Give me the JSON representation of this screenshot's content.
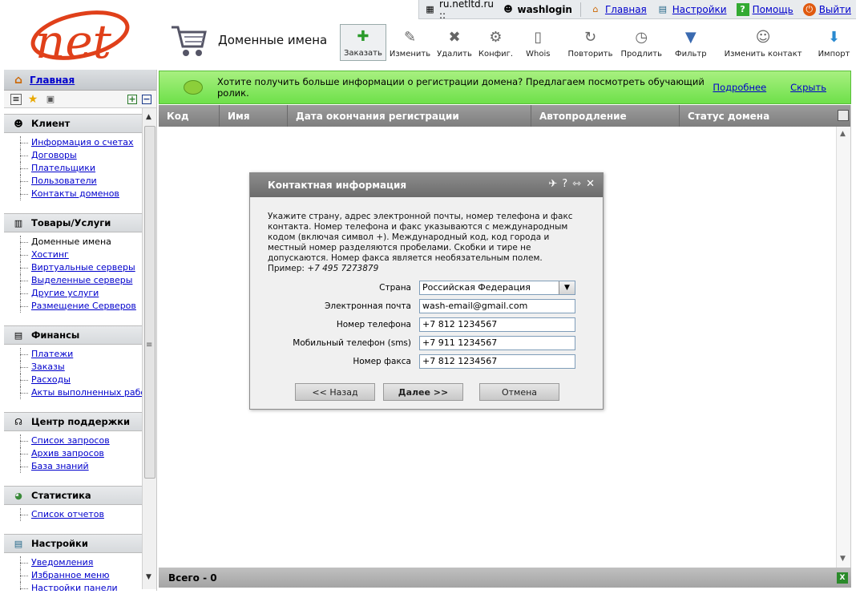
{
  "topbar": {
    "server": "ru.netltd.ru ::",
    "user": "washlogin",
    "links": [
      "Главная",
      "Настройки",
      "Помощь",
      "Выйти"
    ]
  },
  "logo": {
    "text": "net"
  },
  "page": {
    "title": "Доменные имена"
  },
  "toolbar": [
    {
      "label": "Заказать",
      "icon": "plus-doc-icon"
    },
    {
      "label": "Изменить",
      "icon": "edit-icon"
    },
    {
      "label": "Удалить",
      "icon": "delete-icon"
    },
    {
      "label": "Конфиг.",
      "icon": "config-icon"
    },
    {
      "label": "Whois",
      "icon": "whois-icon"
    },
    {
      "label": "Повторить",
      "icon": "repeat-icon"
    },
    {
      "label": "Продлить",
      "icon": "renew-icon"
    },
    {
      "label": "Фильтр",
      "icon": "filter-icon"
    },
    {
      "label": "Изменить контакт",
      "icon": "contact-edit-icon"
    },
    {
      "label": "Импорт",
      "icon": "import-icon"
    }
  ],
  "sidebar": {
    "home": "Главная",
    "groups": [
      {
        "title": "Клиент",
        "items": [
          "Информация о счетах",
          "Договоры",
          "Плательщики",
          "Пользователи",
          "Контакты доменов"
        ]
      },
      {
        "title": "Товары/Услуги",
        "items": [
          "Доменные имена",
          "Хостинг",
          "Виртуальные серверы",
          "Выделенные серверы",
          "Другие услуги",
          "Размещение Серверов"
        ]
      },
      {
        "title": "Финансы",
        "items": [
          "Платежи",
          "Заказы",
          "Расходы",
          "Акты выполненных работ"
        ]
      },
      {
        "title": "Центр поддержки",
        "items": [
          "Список запросов",
          "Архив запросов",
          "База знаний"
        ]
      },
      {
        "title": "Статистика",
        "items": [
          "Список отчетов"
        ]
      },
      {
        "title": "Настройки",
        "items": [
          "Уведомления",
          "Избранное меню",
          "Настройки панели"
        ]
      }
    ]
  },
  "banner": {
    "text": "Хотите получить больше информации о регистрации домена? Предлагаем посмотреть обучающий ролик.",
    "more": "Подробнее",
    "hide": "Скрыть"
  },
  "grid": {
    "columns": [
      "Код",
      "Имя",
      "Дата окончания регистрации",
      "Автопродление",
      "Статус домена"
    ],
    "footer": "Всего - 0"
  },
  "dialog": {
    "title": "Контактная информация",
    "description": "Укажите страну, адрес электронной почты, номер телефона и факс контакта. Номер телефона и факс указываются с международным кодом (включая символ +). Международный код, код города и местный номер разделяются пробелами. Скобки и тире не допускаются. Номер факса является необязательным полем.",
    "example_label": "Пример:",
    "example_value": "+7 495 7273879",
    "fields": [
      {
        "label": "Страна",
        "value": "Российская Федерация"
      },
      {
        "label": "Электронная почта",
        "value": "wash-email@gmail.com"
      },
      {
        "label": "Номер телефона",
        "value": "+7 812 1234567"
      },
      {
        "label": "Мобильный телефон (sms)",
        "value": "+7 911 1234567"
      },
      {
        "label": "Номер факса",
        "value": "+7 812 1234567"
      }
    ],
    "buttons": {
      "back": "<< Назад",
      "next": "Далее >>",
      "cancel": "Отмена"
    }
  },
  "colors": {
    "accent_green": "#6ee04a",
    "logo_red": "#e0401a",
    "link": "#0000cc"
  }
}
